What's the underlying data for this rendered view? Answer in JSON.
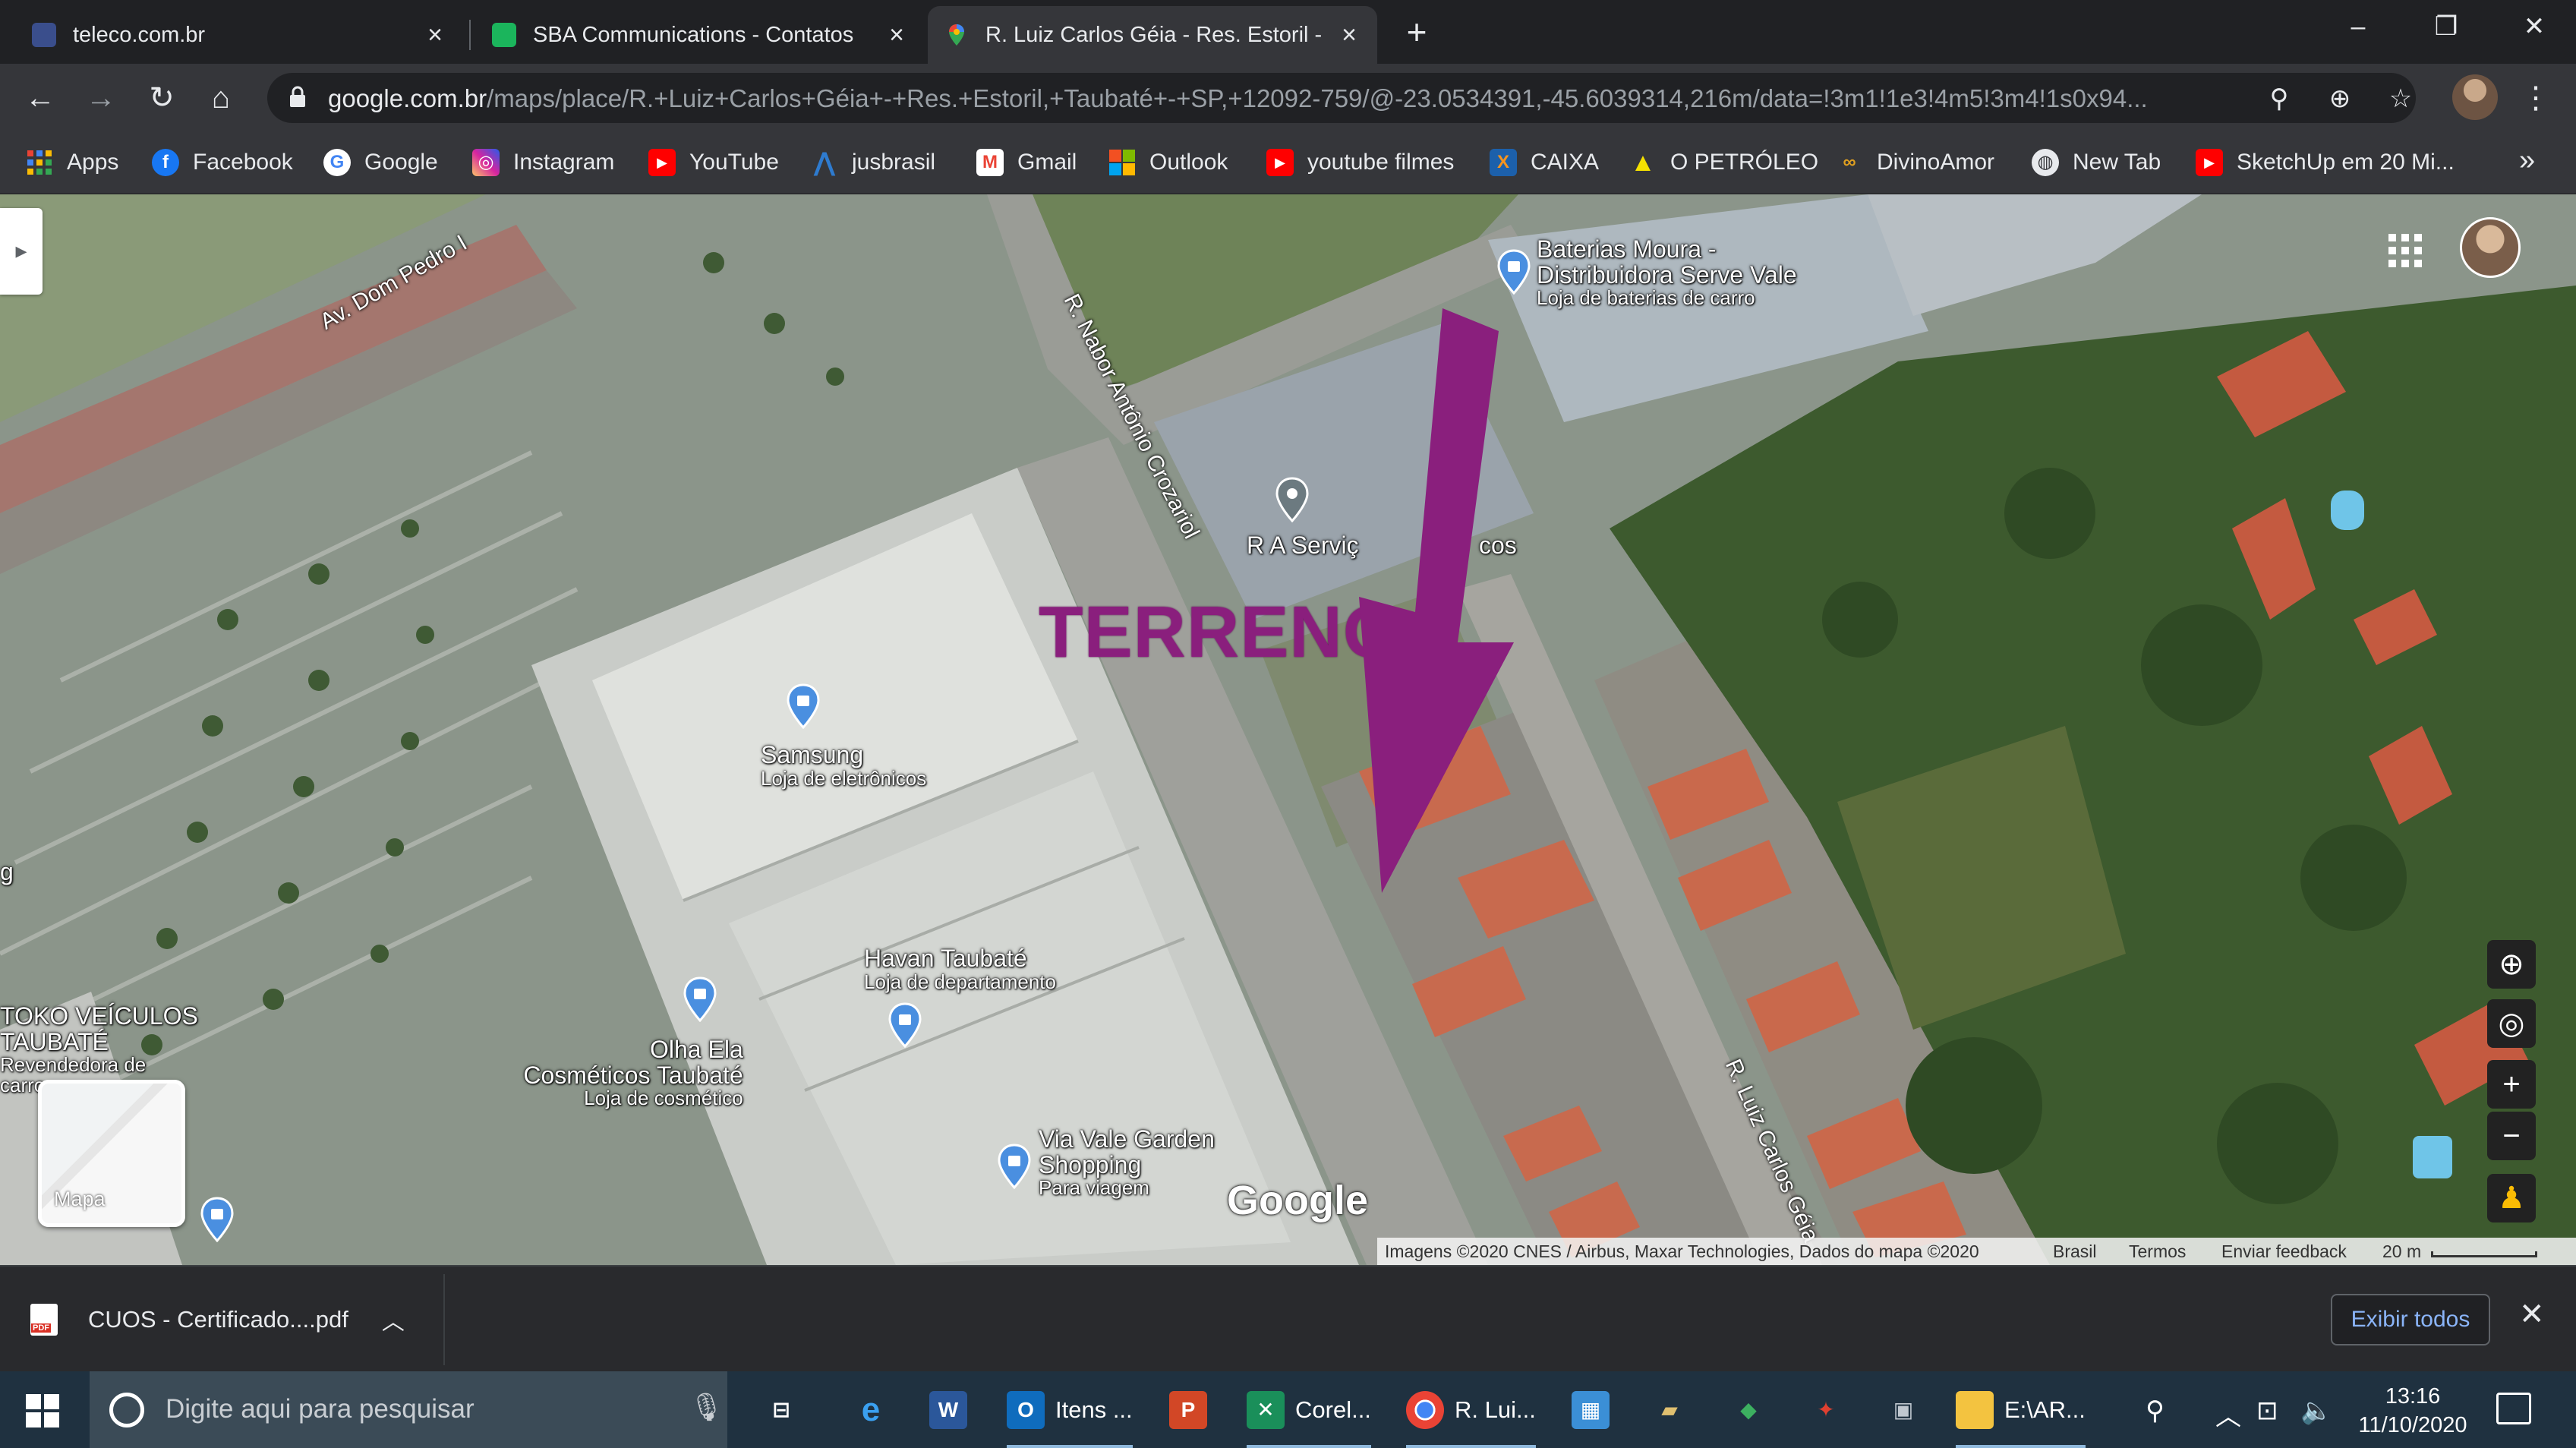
{
  "browser": {
    "tabs": [
      {
        "title": "teleco.com.br",
        "active": false
      },
      {
        "title": "SBA Communications - Contatos",
        "active": false
      },
      {
        "title": "R. Luiz Carlos Géia - Res. Estoril -",
        "active": true
      }
    ],
    "url_host": "google.com.br",
    "url_path": "/maps/place/R.+Luiz+Carlos+Géia+-+Res.+Estoril,+Taubaté+-+SP,+12092-759/@-23.0534391,-45.6039314,216m/data=!3m1!1e3!4m5!3m4!1s0x94...",
    "bookmarks": [
      {
        "label": "Apps",
        "icon": "apps-grid-icon",
        "color": "#4285f4"
      },
      {
        "label": "Facebook",
        "icon": "facebook-icon",
        "color": "#1877f2"
      },
      {
        "label": "Google",
        "icon": "google-icon",
        "color": "#ffffff"
      },
      {
        "label": "Instagram",
        "icon": "instagram-icon",
        "color": "#d6249f"
      },
      {
        "label": "YouTube",
        "icon": "youtube-icon",
        "color": "#ff0000"
      },
      {
        "label": "jusbrasil",
        "icon": "jusbrasil-icon",
        "color": "#2e7bcf"
      },
      {
        "label": "Gmail",
        "icon": "gmail-icon",
        "color": "#ea4335"
      },
      {
        "label": "Outlook",
        "icon": "windows-icon",
        "color": "#f25022"
      },
      {
        "label": "youtube filmes",
        "icon": "youtube-icon",
        "color": "#ff0000"
      },
      {
        "label": "CAIXA",
        "icon": "caixa-icon",
        "color": "#1c60ab"
      },
      {
        "label": "O PETRÓLEO",
        "icon": "triangle-icon",
        "color": "#f5e100"
      },
      {
        "label": "DivinoAmor",
        "icon": "divino-icon",
        "color": "#e0a020"
      },
      {
        "label": "New Tab",
        "icon": "globe-icon",
        "color": "#e8eaed"
      },
      {
        "label": "SketchUp em 20 Mi...",
        "icon": "youtube-icon",
        "color": "#ff0000"
      }
    ]
  },
  "map": {
    "annotation": "TERRENO",
    "annotation_color": "#8a1f7d",
    "streets": {
      "dom_pedro": "Av. Dom Pedro I",
      "nabor": "R. Nabor Antônio Crozariol",
      "luiz_carlos": "R. Luiz Carlos Géia"
    },
    "places": {
      "baterias_title_1": "Baterias Moura -",
      "baterias_title_2": "Distribuidora Serve Vale",
      "baterias_sub": "Loja de baterias de carro",
      "ra_servicos": "R A Serviç",
      "ra_servicos_tail": "cos",
      "samsung": "Samsung",
      "samsung_sub": "Loja de eletrônicos",
      "havan": "Havan Taubaté",
      "havan_sub": "Loja de departamento",
      "olha_ela_1": "Olha Ela",
      "olha_ela_2": "Cosméticos Taubaté",
      "olha_ela_sub": "Loja de cosmético",
      "via_vale_1": "Via Vale Garden",
      "via_vale_2": "Shopping",
      "via_vale_sub": "Para viagem",
      "toko_1": "TOKO VEÍCULOS",
      "toko_2": "TAUBATÉ",
      "toko_sub_1": "Revendedora de",
      "toko_sub_2": "carro",
      "left_edge": "g"
    },
    "google_logo": "Google",
    "minimap_label": "Mapa",
    "attribution": {
      "imagery": "Imagens ©2020 CNES / Airbus, Maxar Technologies, Dados do mapa ©2020",
      "country": "Brasil",
      "terms": "Termos",
      "feedback": "Enviar feedback",
      "scale": "20 m"
    }
  },
  "download": {
    "file": "CUOS - Certificado....pdf",
    "show_all": "Exibir todos"
  },
  "taskbar": {
    "search_placeholder": "Digite aqui para pesquisar",
    "apps": [
      {
        "label": "Itens ..."
      },
      {
        "label": "Corel..."
      },
      {
        "label": "R. Lui..."
      },
      {
        "label": "E:\\AR..."
      }
    ],
    "time": "13:16",
    "date": "11/10/2020"
  }
}
